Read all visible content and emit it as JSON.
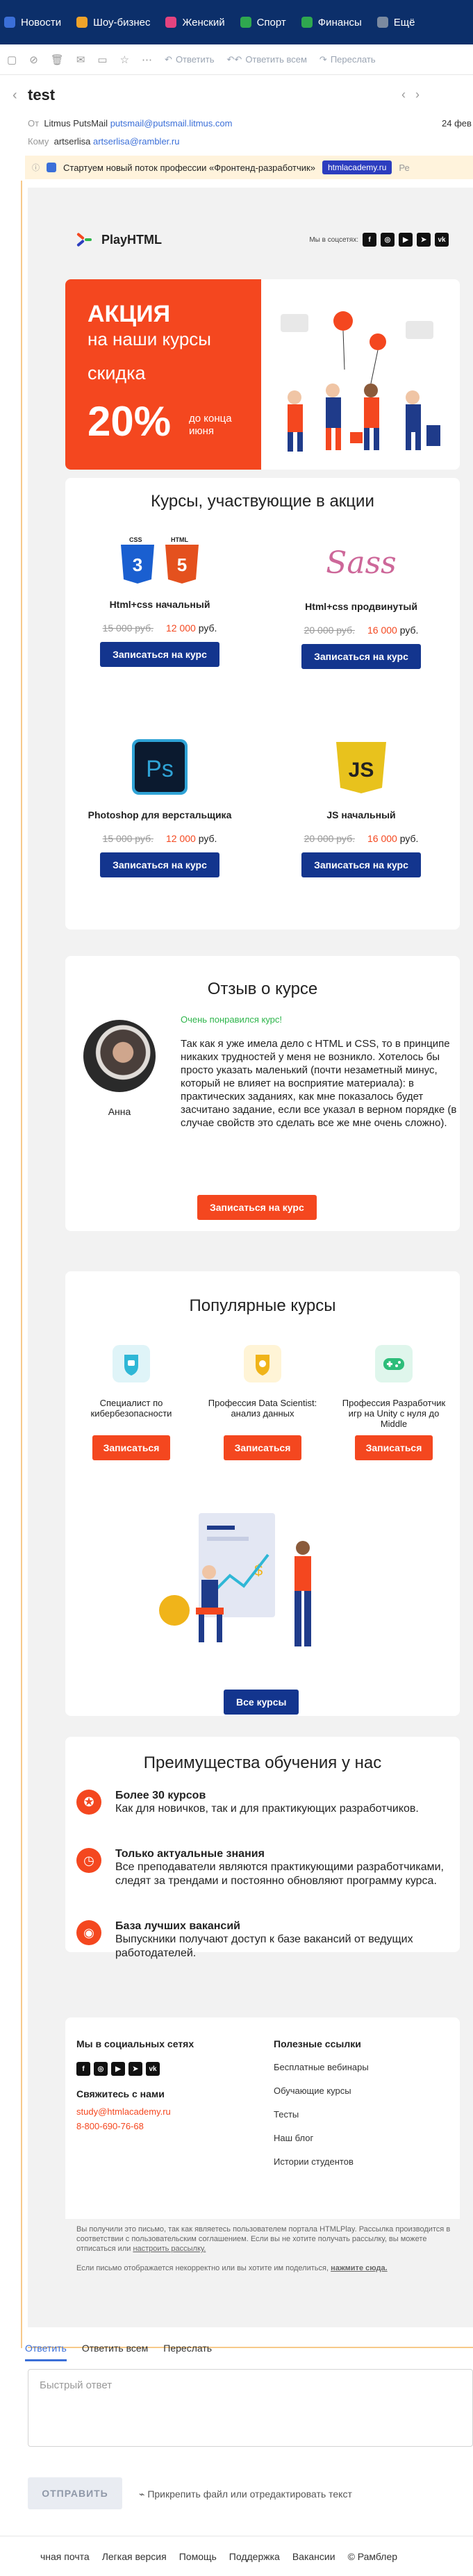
{
  "topnav": {
    "items": [
      {
        "label": "Новости",
        "color": "#3b6fd8"
      },
      {
        "label": "Шоу-бизнес",
        "color": "#f0a32a"
      },
      {
        "label": "Женский",
        "color": "#e4437f"
      },
      {
        "label": "Спорт",
        "color": "#2fa84f"
      },
      {
        "label": "Финансы",
        "color": "#2fa84f"
      },
      {
        "label": "Ещё",
        "color": "#7b8aa0"
      }
    ]
  },
  "toolbar": {
    "reply": "Ответить",
    "reply_all": "Ответить всем",
    "forward": "Переслать"
  },
  "message": {
    "subject": "test",
    "from_label": "От",
    "from_name": "Litmus PutsMail",
    "from_email": "putsmail@putsmail.litmus.com",
    "to_label": "Кому",
    "to_name": "artserlisa",
    "to_email": "artserlisa@rambler.ru",
    "date": "24 фев"
  },
  "ad": {
    "text": "Стартуем новый поток профессии «Фронтенд-разработчик»",
    "tag": "htmlacademy.ru",
    "trailing": "Ре"
  },
  "letter": {
    "brand": "PlayHTML",
    "social_label": "Мы в соцсетях:",
    "promo": {
      "line1": "АКЦИЯ",
      "line2": "на наши курсы",
      "discount_label": "скидка",
      "percent": "20%",
      "until": "до конца\nиюня"
    },
    "courses_title": "Курсы, участвующие в акции",
    "courses": [
      {
        "name": "Html+css начальный",
        "old": "15 000 руб.",
        "new": "12 000",
        "currency": "руб.",
        "button": "Записаться на курс"
      },
      {
        "name": "Html+css продвинутый",
        "old": "20 000 руб.",
        "new": "16 000",
        "currency": "руб.",
        "button": "Записаться на курс"
      },
      {
        "name": "Photoshop для верстальщика",
        "old": "15 000 руб.",
        "new": "12 000",
        "currency": "руб.",
        "button": "Записаться на курс"
      },
      {
        "name": "JS начальный",
        "old": "20 000 руб.",
        "new": "16 000",
        "currency": "руб.",
        "button": "Записаться на курс"
      }
    ],
    "review": {
      "title": "Отзыв о курсе",
      "verdict": "Очень понравился курс!",
      "text": "Так как я уже имела дело с HTML и CSS, то в принципе никаких трудностей у меня не возникло. Хотелось бы просто указать маленький (почти незаметный минус, который не влияет на восприятие материала): в практических заданиях, как мне показалось будет засчитано задание, если все указал в верном порядке (в случае свойств это сделать все же мне очень сложно).",
      "author": "Анна",
      "button": "Записаться на курс"
    },
    "popular_title": "Популярные курсы",
    "popular": [
      {
        "title": "Специалист по кибербезопасности",
        "button": "Записаться"
      },
      {
        "title": "Профессия Data Scientist: анализ данных",
        "button": "Записаться"
      },
      {
        "title": "Профессия Разработчик игр на Unity с нуля до Middle",
        "button": "Записаться"
      }
    ],
    "all_courses_button": "Все курсы",
    "advantages_title": "Преимущества обучения у нас",
    "advantages": [
      {
        "title": "Более 30 курсов",
        "text": "Как для новичков, так и для практикующих разработчиков."
      },
      {
        "title": "Только актуальные знания",
        "text": "Все преподаватели являются практикующими разработчиками, следят за трендами и постоянно обновляют программу курса."
      },
      {
        "title": "База лучших вакансий",
        "text": "Выпускники получают доступ к базе вакансий от ведущих работодателей."
      }
    ],
    "footer": {
      "social_title": "Мы в социальных сетях",
      "contact_title": "Свяжитесь с нами",
      "email": "study@htmlacademy.ru",
      "phone": "8-800-690-76-68",
      "links_title": "Полезные ссылки",
      "links": [
        "Бесплатные вебинары",
        "Обучающие курсы",
        "Тесты",
        "Наш блог",
        "Истории студентов"
      ],
      "disclaimer1": "Вы получили это письмо, так как являетесь пользователем портала HTMLPlay. Рассылка производится в соответствии с пользовательским соглашением. Если вы не хотите получать рассылку, вы можете отписаться или",
      "disclaimer_link1": "настроить рассылку.",
      "disclaimer2": "Если письмо отображается некорректно или вы хотите им поделиться,",
      "disclaimer_link2": "нажмите сюда."
    }
  },
  "reply": {
    "tabs": [
      "Ответить",
      "Ответить всем",
      "Переслать"
    ],
    "placeholder": "Быстрый ответ",
    "send": "ОТПРАВИТЬ",
    "attach": "Прикрепить файл или отредактировать текст"
  },
  "bottom": {
    "links": [
      "чная почта",
      "Легкая версия",
      "Помощь",
      "Поддержка",
      "Вакансии",
      "© Рамблер"
    ]
  }
}
